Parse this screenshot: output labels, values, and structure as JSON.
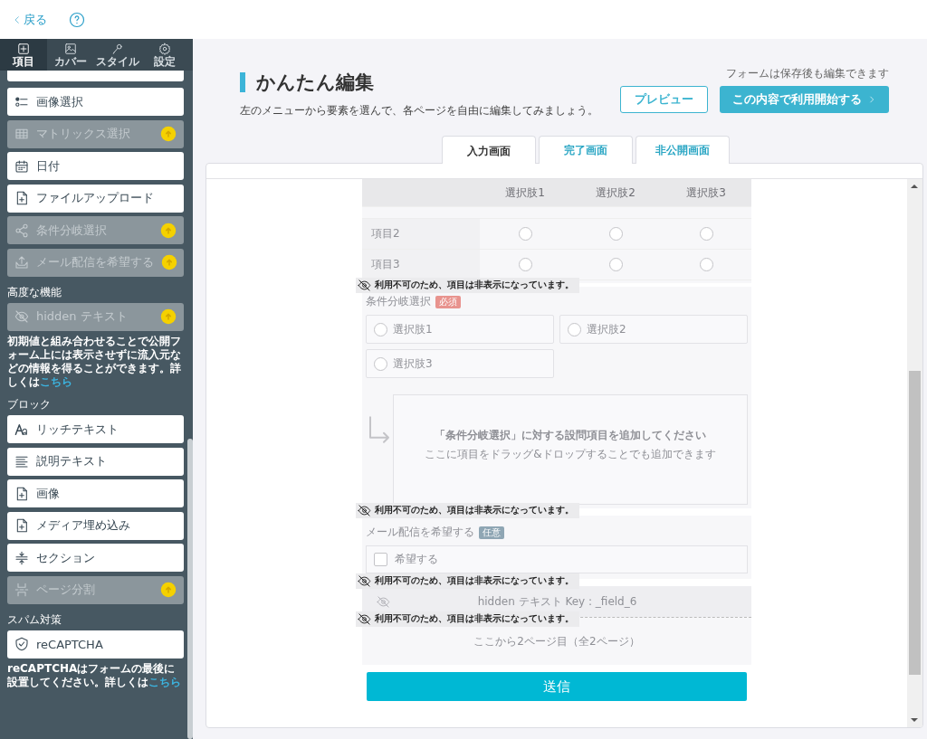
{
  "topbar": {
    "back_label": "戻る"
  },
  "sidebar": {
    "tabs": [
      {
        "label": "項目",
        "selected": true
      },
      {
        "label": "カバー",
        "selected": false
      },
      {
        "label": "スタイル",
        "selected": false
      },
      {
        "label": "設定",
        "selected": false
      }
    ],
    "groups": [
      {
        "items": [
          {
            "label": "画像選択",
            "disabled": false
          },
          {
            "label": "マトリックス選択",
            "disabled": true
          },
          {
            "label": "日付",
            "disabled": false
          },
          {
            "label": "ファイルアップロード",
            "disabled": false
          },
          {
            "label": "条件分岐選択",
            "disabled": true
          },
          {
            "label": "メール配信を希望する",
            "disabled": true
          }
        ]
      },
      {
        "title": "高度な機能",
        "items": [
          {
            "label": "hidden テキスト",
            "disabled": true
          }
        ],
        "note": "初期値と組み合わせることで公開フォーム上には表示させずに流入元などの情報を得ることができます。詳しくは",
        "note_link": "こちら"
      },
      {
        "title": "ブロック",
        "items": [
          {
            "label": "リッチテキスト",
            "disabled": false
          },
          {
            "label": "説明テキスト",
            "disabled": false
          },
          {
            "label": "画像",
            "disabled": false
          },
          {
            "label": "メディア埋め込み",
            "disabled": false
          },
          {
            "label": "セクション",
            "disabled": false
          },
          {
            "label": "ページ分割",
            "disabled": true
          }
        ]
      },
      {
        "title": "スパム対策",
        "items": [
          {
            "label": "reCAPTCHA",
            "disabled": false
          }
        ],
        "note": "reCAPTCHAはフォームの最後に設置してください。詳しくは",
        "note_link": "こちら"
      }
    ]
  },
  "header": {
    "title": "かんたん編集",
    "subtitle": "左のメニューから要素を選んで、各ページを自由に編集してみましょう。",
    "save_note": "フォームは保存後も編集できます",
    "preview_button": "プレビュー",
    "start_button": "この内容で利用開始する"
  },
  "tabs": [
    {
      "label": "入力画面",
      "selected": true
    },
    {
      "label": "完了画面",
      "selected": false
    },
    {
      "label": "非公開画面",
      "selected": false
    }
  ],
  "form": {
    "blocks": [
      {
        "kind": "matrix",
        "columns": [
          "選択肢1",
          "選択肢2",
          "選択肢3"
        ],
        "rows": [
          {
            "label": "項目2",
            "cells": [
              {
                "selected": false
              },
              {
                "selected": false
              },
              {
                "selected": false
              }
            ]
          },
          {
            "label": "項目3",
            "cells": [
              {
                "selected": false
              },
              {
                "selected": false
              },
              {
                "selected": false
              }
            ]
          }
        ],
        "notice": "利用不可のため、項目は非表示になっています。"
      },
      {
        "kind": "branch",
        "label": "条件分岐選択",
        "badge": "必須",
        "required": true,
        "options": [
          {
            "label": "選択肢1",
            "selected": false
          },
          {
            "label": "選択肢2",
            "selected": false
          },
          {
            "label": "選択肢3",
            "selected": false
          }
        ],
        "drop_title": "「条件分岐選択」に対する設問項目を追加してください",
        "drop_hint": "ここに項目をドラッグ&ドロップすることでも追加できます",
        "notice": "利用不可のため、項目は非表示になっています。"
      },
      {
        "kind": "checkbox",
        "label": "メール配信を希望する",
        "badge": "任意",
        "required": false,
        "options": [
          {
            "label": "希望する",
            "checked": false
          }
        ],
        "notice": "利用不可のため、項目は非表示になっています。"
      },
      {
        "kind": "hidden",
        "label": "hidden テキスト Key : _field_6",
        "notice": "利用不可のため、項目は非表示になっています。"
      },
      {
        "kind": "pagebreak",
        "label": "ここから2ページ目（全2ページ）"
      }
    ],
    "submit": "送信"
  }
}
